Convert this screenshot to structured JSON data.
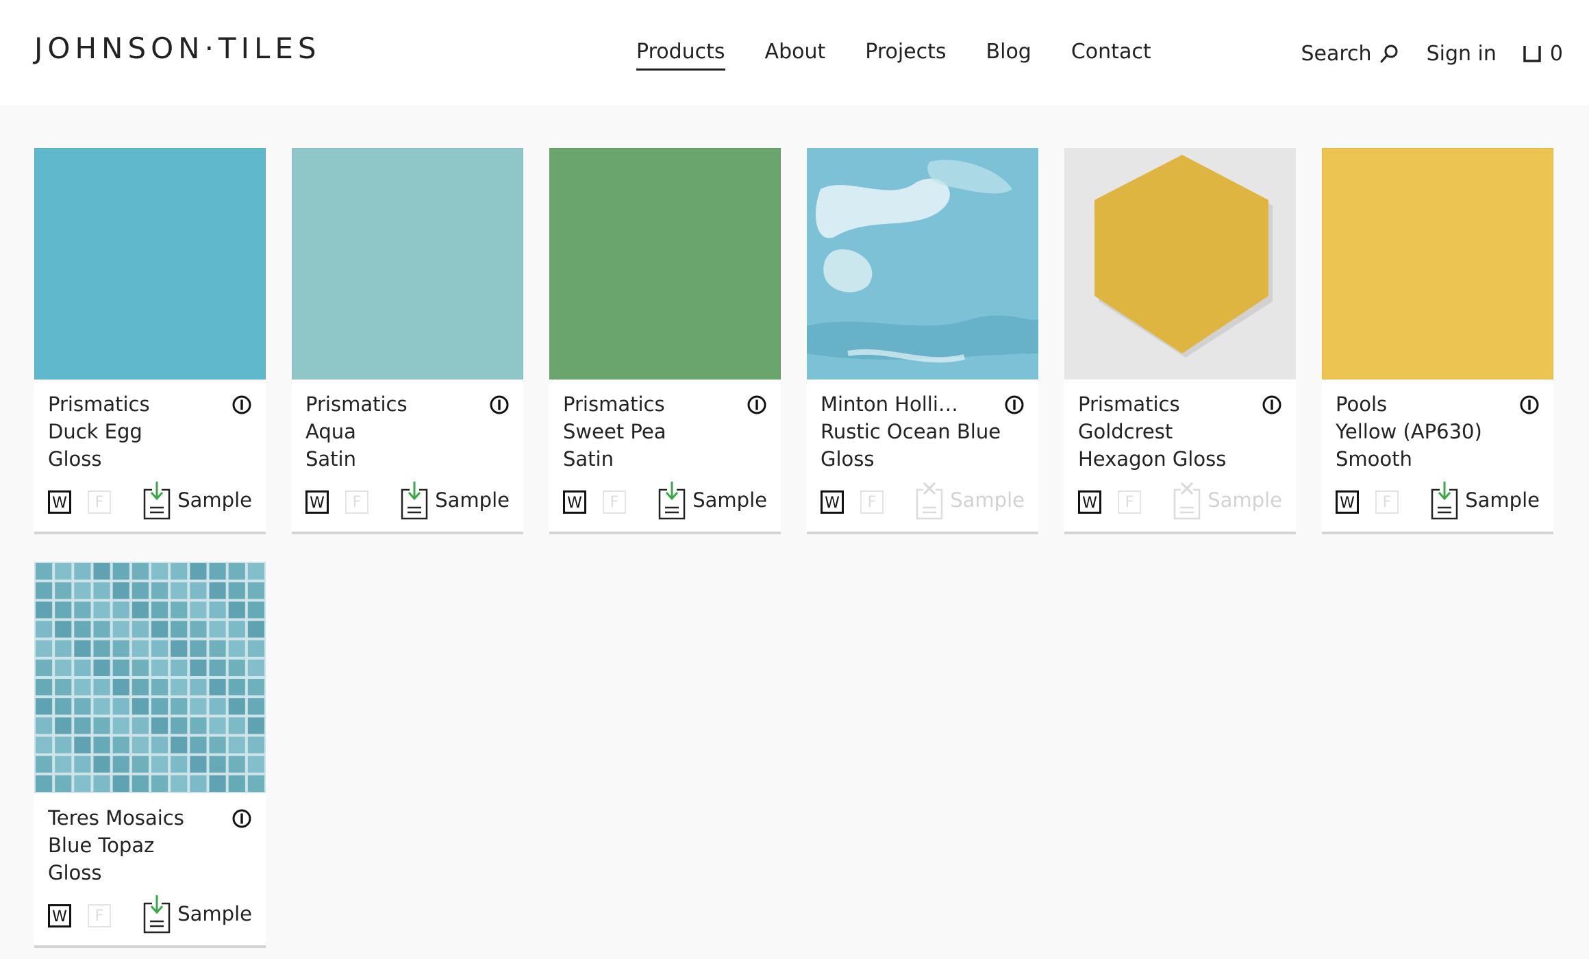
{
  "header": {
    "logo": "JOHNSON·TILES",
    "nav": [
      "Products",
      "About",
      "Projects",
      "Blog",
      "Contact"
    ],
    "active_nav": "Products",
    "search_label": "Search",
    "signin_label": "Sign in",
    "cart_count": "0"
  },
  "products": [
    {
      "line1": "Prismatics",
      "line2": "Duck Egg",
      "line3": "Gloss",
      "wall": "W",
      "floor": "F",
      "sample": "Sample",
      "sample_available": true,
      "swatch": "#5fb8cc"
    },
    {
      "line1": "Prismatics",
      "line2": "Aqua",
      "line3": "Satin",
      "wall": "W",
      "floor": "F",
      "sample": "Sample",
      "sample_available": true,
      "swatch": "#8fc7c9"
    },
    {
      "line1": "Prismatics",
      "line2": "Sweet Pea",
      "line3": "Satin",
      "wall": "W",
      "floor": "F",
      "sample": "Sample",
      "sample_available": true,
      "swatch": "#69a56c"
    },
    {
      "line1": "Minton Holli…",
      "line2": "Rustic Ocean Blue",
      "line3": "Gloss",
      "wall": "W",
      "floor": "F",
      "sample": "Sample",
      "sample_available": false,
      "swatch": "#7cc1d6"
    },
    {
      "line1": "Prismatics",
      "line2": "Goldcrest",
      "line3": "Hexagon Gloss",
      "wall": "W",
      "floor": "F",
      "sample": "Sample",
      "sample_available": false,
      "swatch": "#dfb542"
    },
    {
      "line1": "Pools",
      "line2": "Yellow (AP630)",
      "line3": "Smooth",
      "wall": "W",
      "floor": "F",
      "sample": "Sample",
      "sample_available": true,
      "swatch": "#ebc452"
    },
    {
      "line1": "Teres Mosaics",
      "line2": "Blue Topaz",
      "line3": "Gloss",
      "wall": "W",
      "floor": "F",
      "sample": "Sample",
      "sample_available": true,
      "swatch": "#6fb0bd"
    }
  ]
}
